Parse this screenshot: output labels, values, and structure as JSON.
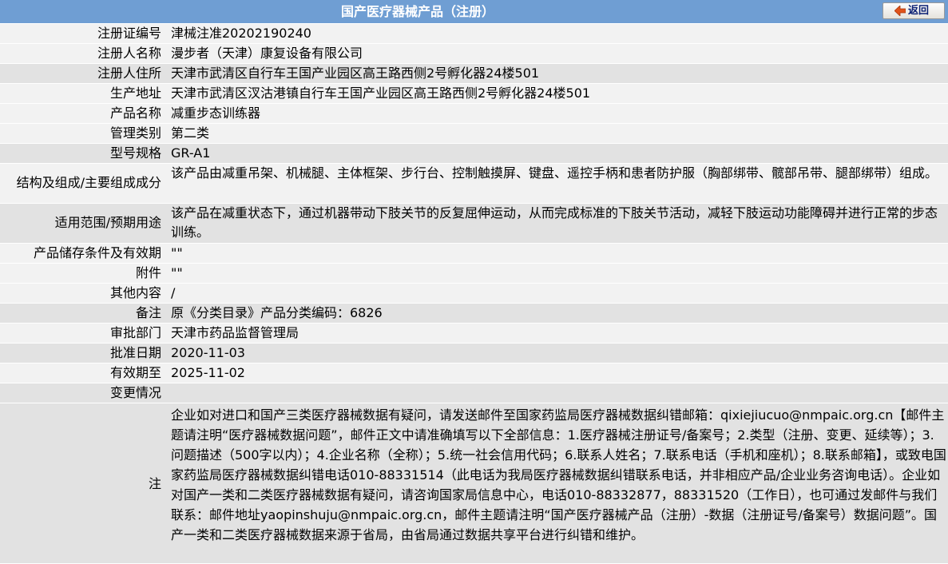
{
  "header": {
    "title": "国产医疗器械产品（注册）",
    "back_label": "返回",
    "back_icon": "back-arrow-icon",
    "bar_color": "#6f9ed3"
  },
  "rows": [
    {
      "label": "注册证编号",
      "value": "津械注准20202190240"
    },
    {
      "label": "注册人名称",
      "value": "漫步者（天津）康复设备有限公司"
    },
    {
      "label": "注册人住所",
      "value": "天津市武清区自行车王国产业园区高王路西侧2号孵化器24楼501"
    },
    {
      "label": "生产地址",
      "value": "天津市武清区汊沽港镇自行车王国产业园区高王路西侧2号孵化器24楼501"
    },
    {
      "label": "产品名称",
      "value": "减重步态训练器"
    },
    {
      "label": "管理类别",
      "value": "第二类"
    },
    {
      "label": "型号规格",
      "value": "GR-A1"
    },
    {
      "label": "结构及组成/主要组成成分",
      "value": "该产品由减重吊架、机械腿、主体框架、步行台、控制触摸屏、键盘、遥控手柄和患者防护服（胸部绑带、髋部吊带、腿部绑带）组成。"
    },
    {
      "label": "适用范围/预期用途",
      "value": "该产品在减重状态下，通过机器带动下肢关节的反复屈伸运动，从而完成标准的下肢关节活动，减轻下肢运动功能障碍并进行正常的步态训练。"
    },
    {
      "label": "产品储存条件及有效期",
      "value": "\"\""
    },
    {
      "label": "附件",
      "value": "\"\""
    },
    {
      "label": "其他内容",
      "value": "/"
    },
    {
      "label": "备注",
      "value": "原《分类目录》产品分类编码：6826"
    },
    {
      "label": "审批部门",
      "value": "天津市药品监督管理局"
    },
    {
      "label": "批准日期",
      "value": "2020-11-03"
    },
    {
      "label": "有效期至",
      "value": "2025-11-02"
    },
    {
      "label": "变更情况",
      "value": ""
    },
    {
      "label": "注",
      "value": "企业如对进口和国产三类医疗器械数据有疑问，请发送邮件至国家药监局医疗器械数据纠错邮箱：qixiejiucuo@nmpaic.org.cn【邮件主题请注明“医疗器械数据问题”，邮件正文中请准确填写以下全部信息：1.医疗器械注册证号/备案号；2.类型（注册、变更、延续等）；3.问题描述（500字以内）；4.企业名称（全称）；5.统一社会信用代码；6.联系人姓名；7.联系电话（手机和座机）；8.联系邮箱】，或致电国家药监局医疗器械数据纠错电话010-88331514（此电话为我局医疗器械数据纠错联系电话，并非相应产品/企业业务咨询电话）。企业如对国产一类和二类医疗器械数据有疑问，请咨询国家局信息中心，电话010-88332877，88331520（工作日），也可通过发邮件与我们联系：邮件地址yaopinshuju@nmpaic.org.cn，邮件主题请注明“国产医疗器械产品（注册）-数据（注册证号/备案号）数据问题”。国产一类和二类医疗器械数据来源于省局，由省局通过数据共享平台进行纠错和维护。"
    }
  ]
}
